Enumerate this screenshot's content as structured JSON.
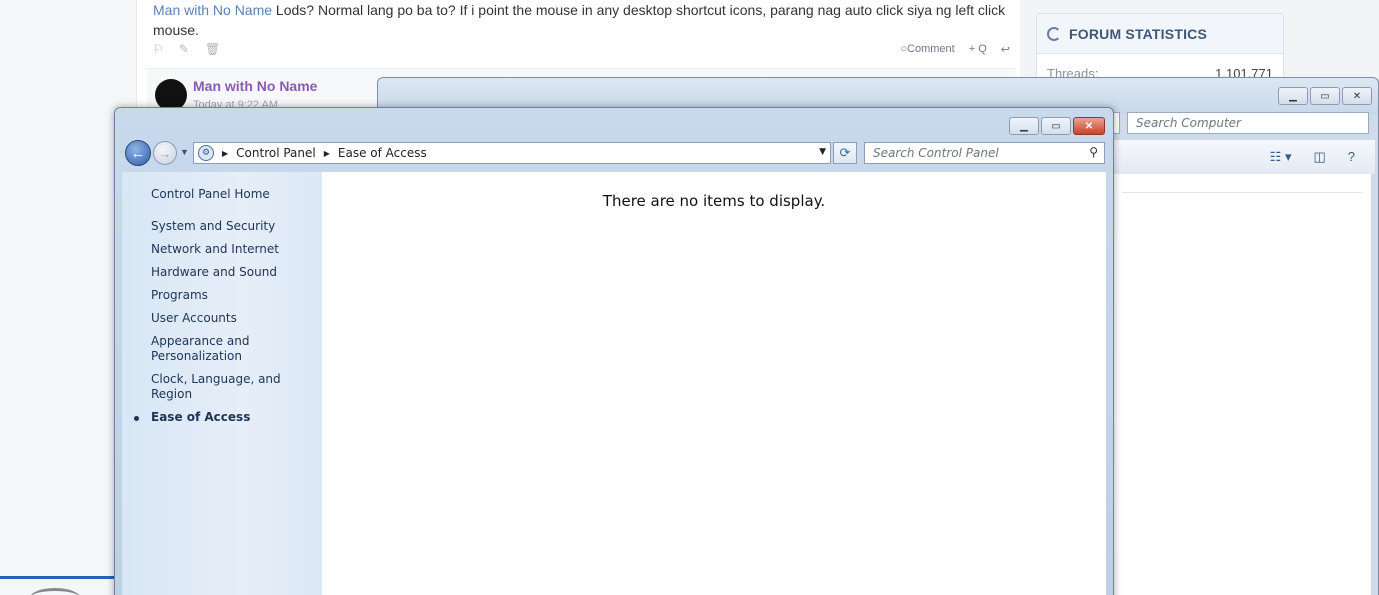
{
  "forum": {
    "post": {
      "author_link": "Man with No Name",
      "text": " Lods? Normal lang po ba to? If i point the mouse in any desktop shortcut icons, parang nag auto click siya ng left click mouse.",
      "actions": {
        "comment": "Comment",
        "quote": "+ Q"
      }
    },
    "reply": {
      "author": "Man with No Name",
      "time": "Today at 9:22 AM"
    },
    "stats": {
      "title": "FORUM STATISTICS",
      "threads_label": "Threads:",
      "threads_value": "1,101,771"
    }
  },
  "explorer_back": {
    "search_placeholder": "Search Computer"
  },
  "control_panel": {
    "breadcrumb": [
      "Control Panel",
      "Ease of Access"
    ],
    "search_placeholder": "Search Control Panel",
    "sidebar": {
      "home": "Control Panel Home",
      "items": [
        {
          "label": "System and Security",
          "active": false
        },
        {
          "label": "Network and Internet",
          "active": false
        },
        {
          "label": "Hardware and Sound",
          "active": false
        },
        {
          "label": "Programs",
          "active": false
        },
        {
          "label": "User Accounts",
          "active": false
        },
        {
          "label": "Appearance and Personalization",
          "active": false
        },
        {
          "label": "Clock, Language, and Region",
          "active": false
        },
        {
          "label": "Ease of Access",
          "active": true
        }
      ]
    },
    "empty_message": "There are no items to display."
  },
  "colors": {
    "forum_link": "#5b80b6",
    "reply_author": "#8a5bb3",
    "close_button": "#c8432b",
    "sidebar_text": "#1e3457"
  },
  "icons": {
    "flag": "flag-icon",
    "edit": "edit-icon",
    "delete": "trash-icon",
    "comment": "comment-icon",
    "reply": "reply-icon",
    "stats": "pie-chart-icon",
    "back": "back-arrow-icon",
    "forward": "forward-arrow-icon",
    "refresh": "refresh-icon",
    "search": "search-icon"
  }
}
